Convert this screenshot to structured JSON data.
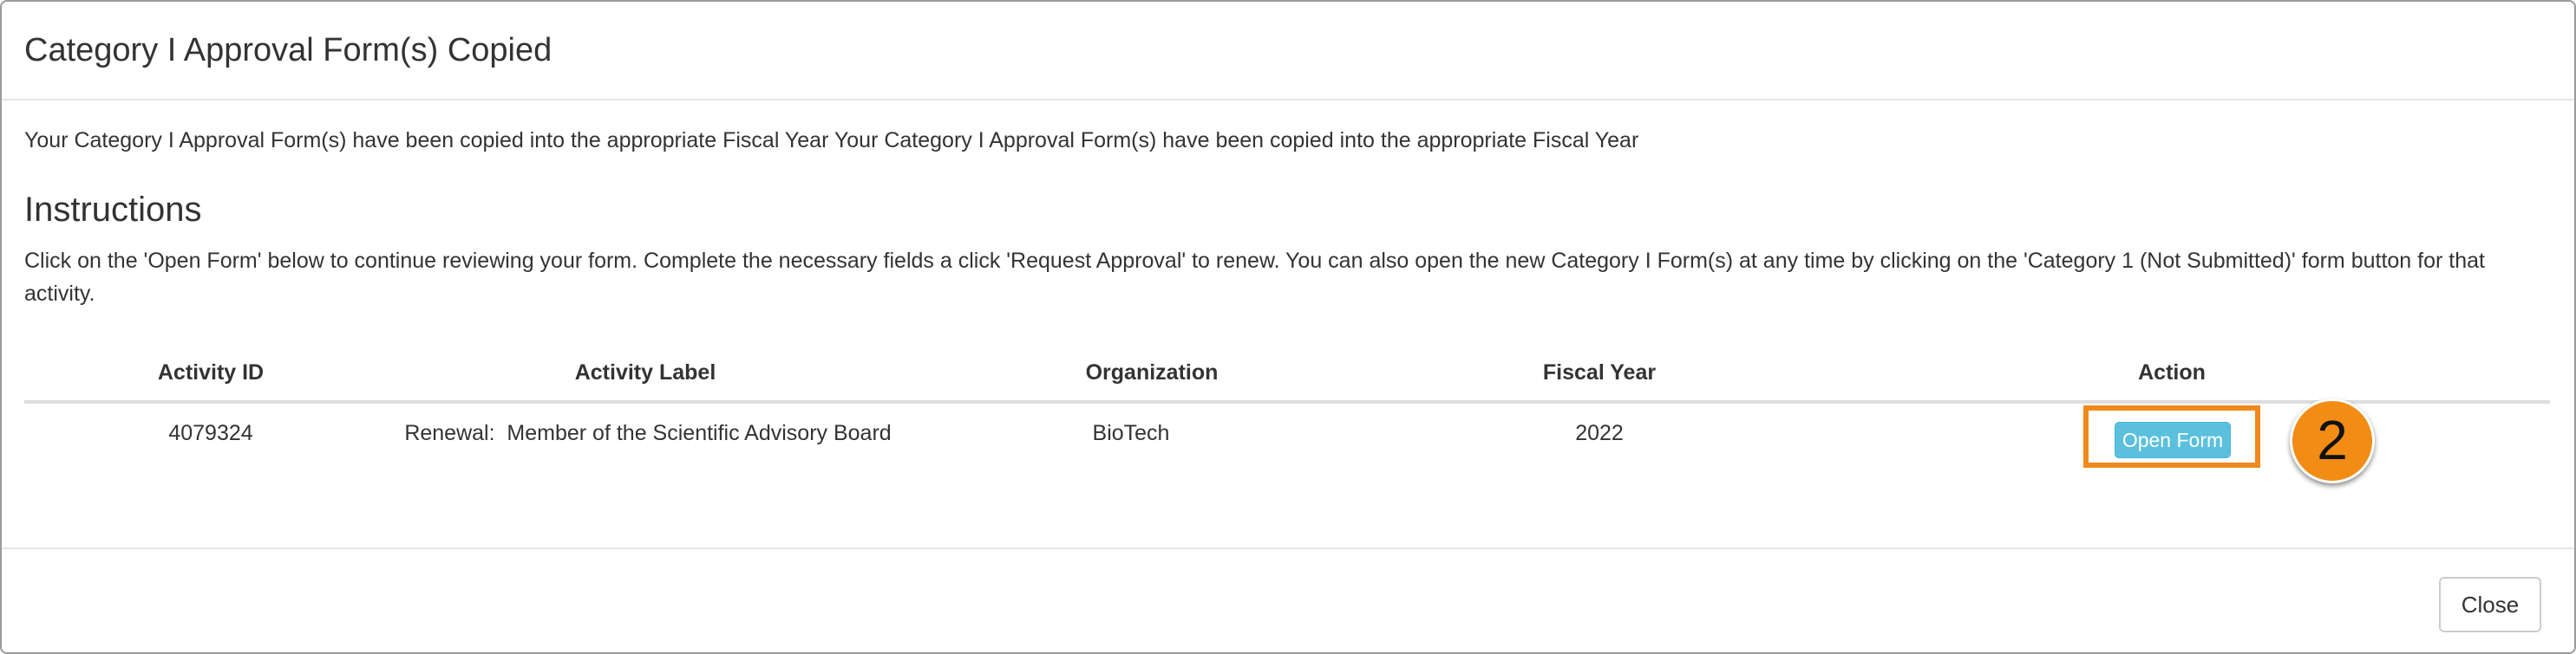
{
  "modal": {
    "title": "Category I Approval Form(s) Copied",
    "intro": "Your Category I Approval Form(s) have been copied into the appropriate Fiscal Year Your Category I Approval Form(s) have been copied into the appropriate Fiscal Year",
    "instructions_heading": "Instructions",
    "instructions_text": "Click on the 'Open Form' below to continue reviewing your form. Complete the necessary fields a click 'Request Approval' to renew. You can also open the new Category I Form(s) at any time by clicking on the 'Category 1 (Not Submitted)' form button for that activity."
  },
  "table": {
    "headers": [
      "Activity ID",
      "Activity Label",
      "Organization",
      "Fiscal Year",
      "Action"
    ],
    "rows": [
      {
        "activity_id": "4079324",
        "activity_label": "Renewal:  Member of the Scientific Advisory Board",
        "organization": "BioTech",
        "fiscal_year": "2022",
        "action_label": "Open Form"
      }
    ]
  },
  "annotation": {
    "step_number": "2",
    "highlight_color": "#f0891c",
    "badge_color": "#f28c14"
  },
  "footer": {
    "close_label": "Close"
  },
  "colors": {
    "info_button": "#5bc0de",
    "text": "#333333",
    "divider": "#e5e5e5"
  }
}
